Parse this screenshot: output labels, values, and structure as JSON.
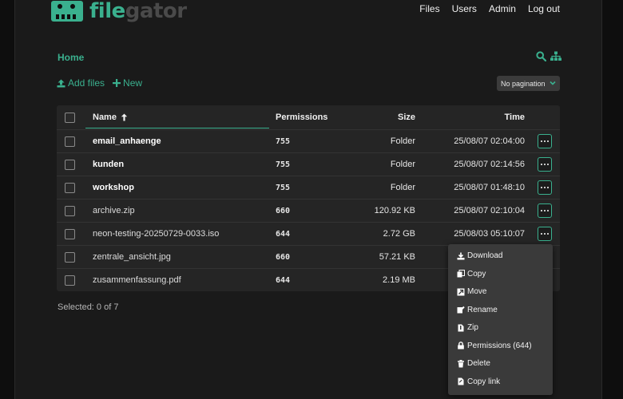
{
  "app": {
    "logo_text_1": "file",
    "logo_text_2": "gator"
  },
  "nav": {
    "files": "Files",
    "users": "Users",
    "admin": "Admin",
    "logout": "Log out"
  },
  "breadcrumb": {
    "home": "Home"
  },
  "toolbar": {
    "add_files": "Add files",
    "new": "New",
    "pagination": "No pagination"
  },
  "table": {
    "columns": {
      "name": "Name",
      "name_sort_icon": "arrow-up-icon",
      "permissions": "Permissions",
      "size": "Size",
      "time": "Time"
    },
    "rows": [
      {
        "name": "email_anhaenge",
        "permissions": "755",
        "size": "Folder",
        "time": "25/08/07 02:04:00",
        "bold": true
      },
      {
        "name": "kunden",
        "permissions": "755",
        "size": "Folder",
        "time": "25/08/07 02:14:56",
        "bold": true
      },
      {
        "name": "workshop",
        "permissions": "755",
        "size": "Folder",
        "time": "25/08/07 01:48:10",
        "bold": true
      },
      {
        "name": "archive.zip",
        "permissions": "660",
        "size": "120.92 KB",
        "time": "25/08/07 02:10:04",
        "bold": false
      },
      {
        "name": "neon-testing-20250729-0033.iso",
        "permissions": "644",
        "size": "2.72 GB",
        "time": "25/08/03 05:10:07",
        "bold": false
      },
      {
        "name": "zentrale_ansicht.jpg",
        "permissions": "660",
        "size": "57.21 KB",
        "time": "",
        "bold": false
      },
      {
        "name": "zusammenfassung.pdf",
        "permissions": "644",
        "size": "2.19 MB",
        "time": "",
        "bold": false
      }
    ]
  },
  "selection": {
    "text": "Selected: 0 of 7"
  },
  "context_menu": {
    "items": [
      {
        "label": "Download",
        "icon": "download-icon"
      },
      {
        "label": "Copy",
        "icon": "copy-icon"
      },
      {
        "label": "Move",
        "icon": "move-icon"
      },
      {
        "label": "Rename",
        "icon": "rename-icon"
      },
      {
        "label": "Zip",
        "icon": "zip-icon"
      },
      {
        "label": "Permissions (644)",
        "icon": "lock-icon"
      },
      {
        "label": "Delete",
        "icon": "trash-icon"
      },
      {
        "label": "Copy link",
        "icon": "link-copy-icon"
      }
    ]
  },
  "colors": {
    "accent": "#3ab08e",
    "background": "#1a1a1a",
    "panel": "#252525",
    "menu": "#3a3a3a"
  }
}
